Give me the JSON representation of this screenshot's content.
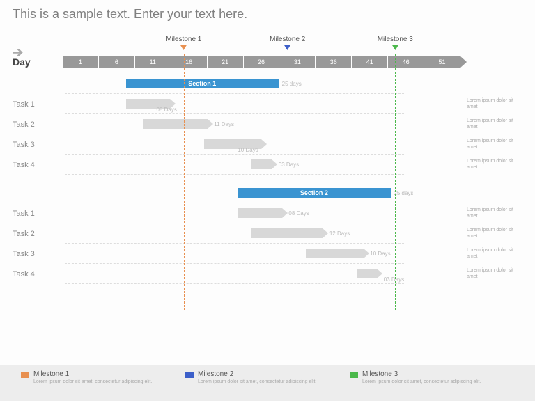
{
  "title": "This is a sample text. Enter your text here.",
  "axis": {
    "label": "Day",
    "ticks": [
      "1",
      "6",
      "11",
      "16",
      "21",
      "26",
      "31",
      "36",
      "41",
      "46",
      "51"
    ]
  },
  "milestones": [
    {
      "label": "Milestone 1",
      "day": 16,
      "color": "#e89050",
      "markerStyle": "border-top:8px solid #e89050"
    },
    {
      "label": "Milestone 2",
      "day": 31,
      "color": "#3c5fc9",
      "markerStyle": "border-top:8px solid #3c5fc9"
    },
    {
      "label": "Milestone 3",
      "day": 46,
      "color": "#4bb84b",
      "markerStyle": "border-top:8px solid #4bb84b"
    }
  ],
  "sections": [
    {
      "name": "Section 1",
      "duration": "25 days",
      "tasks": [
        {
          "name": "Task 1",
          "duration": "08 Days",
          "desc": "Lorem ipsum dolor sit amet"
        },
        {
          "name": "Task 2",
          "duration": "11 Days",
          "desc": "Lorem ipsum dolor sit amet"
        },
        {
          "name": "Task 3",
          "duration": "10 Days",
          "desc": "Lorem ipsum dolor sit amet"
        },
        {
          "name": "Task 4",
          "duration": "03 Days",
          "desc": "Lorem ipsum dolor sit amet"
        }
      ]
    },
    {
      "name": "Section 2",
      "duration": "25 days",
      "tasks": [
        {
          "name": "Task 1",
          "duration": "08 Days",
          "desc": "Lorem ipsum dolor sit amet"
        },
        {
          "name": "Task 2",
          "duration": "12 Days",
          "desc": "Lorem ipsum dolor sit amet"
        },
        {
          "name": "Task 3",
          "duration": "10 Days",
          "desc": "Lorem ipsum dolor sit amet"
        },
        {
          "name": "Task 4",
          "duration": "03 Days",
          "desc": "Lorem ipsum dolor sit amet"
        }
      ]
    }
  ],
  "legend": [
    {
      "title": "Milestone 1",
      "desc": "Lorem ipsum dolor sit amet, consectetur adipiscing elit.",
      "swatchStyle": "background:#e89050"
    },
    {
      "title": "Milestone 2",
      "desc": "Lorem ipsum dolor sit amet, consectetur adipiscing elit.",
      "swatchStyle": "background:#3c5fc9"
    },
    {
      "title": "Milestone 3",
      "desc": "Lorem ipsum dolor sit amet, consectetur adipiscing elit.",
      "swatchStyle": "background:#4bb84b"
    }
  ],
  "chart_data": {
    "type": "gantt",
    "axis_unit": "Day",
    "range": [
      1,
      55
    ],
    "ticks": [
      1,
      6,
      11,
      16,
      21,
      26,
      31,
      36,
      41,
      46,
      51
    ],
    "milestones": [
      {
        "name": "Milestone 1",
        "day": 16
      },
      {
        "name": "Milestone 2",
        "day": 31
      },
      {
        "name": "Milestone 3",
        "day": 46
      }
    ],
    "sections": [
      {
        "name": "Section 1",
        "start": 11,
        "duration": 25,
        "tasks": [
          {
            "name": "Task 1",
            "start": 11,
            "duration": 8
          },
          {
            "name": "Task 2",
            "start": 14,
            "duration": 11
          },
          {
            "name": "Task 3",
            "start": 24,
            "duration": 10
          },
          {
            "name": "Task 4",
            "start": 31,
            "duration": 3
          }
        ]
      },
      {
        "name": "Section 2",
        "start": 29,
        "duration": 25,
        "tasks": [
          {
            "name": "Task 1",
            "start": 29,
            "duration": 8
          },
          {
            "name": "Task 2",
            "start": 31,
            "duration": 12
          },
          {
            "name": "Task 3",
            "start": 40,
            "duration": 10
          },
          {
            "name": "Task 4",
            "start": 48,
            "duration": 3
          }
        ]
      }
    ]
  }
}
